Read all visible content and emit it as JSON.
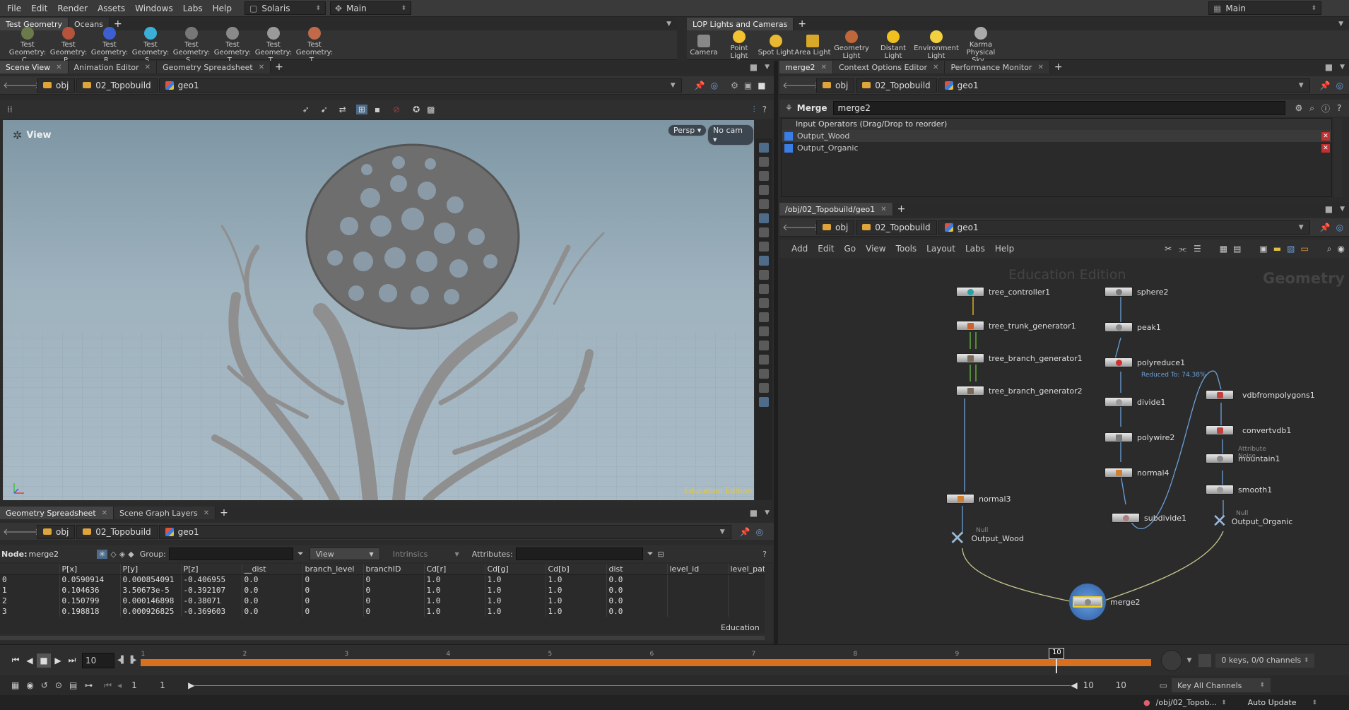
{
  "menubar": {
    "items": [
      "File",
      "Edit",
      "Render",
      "Assets",
      "Windows",
      "Labs",
      "Help"
    ],
    "desktop": "Solaris",
    "context": "Main",
    "right_desktop": "Main"
  },
  "shelf_left": {
    "tabs": [
      "Test Geometry",
      "Oceans"
    ],
    "items": [
      "Test Geometry: C...",
      "Test Geometry: P...",
      "Test Geometry: R...",
      "Test Geometry: S...",
      "Test Geometry: S...",
      "Test Geometry: T...",
      "Test Geometry: T...",
      "Test Geometry: T..."
    ]
  },
  "shelf_right": {
    "tabs": [
      "LOP Lights and Cameras"
    ],
    "items": [
      "Camera",
      "Point Light",
      "Spot Light",
      "Area Light",
      "Geometry Light",
      "Distant Light",
      "Environment Light",
      "Karma Physical Sky..."
    ]
  },
  "left_top_tabs": [
    "Scene View",
    "Animation Editor",
    "Geometry Spreadsheet"
  ],
  "path": {
    "obj": "obj",
    "net": "02_Topobuild",
    "geo": "geo1"
  },
  "viewport": {
    "label": "View",
    "persp": "Persp",
    "cam": "No cam",
    "watermark": "Education Edition"
  },
  "right_top_tabs": [
    "merge2",
    "Context Options Editor",
    "Performance Monitor"
  ],
  "parm": {
    "type": "Merge",
    "name": "merge2",
    "list_header": "Input Operators (Drag/Drop to reorder)",
    "inputs": [
      "Output_Wood",
      "Output_Organic"
    ]
  },
  "network": {
    "tab": "/obj/02_Topobuild/geo1",
    "menu": [
      "Add",
      "Edit",
      "Go",
      "View",
      "Tools",
      "Layout",
      "Labs",
      "Help"
    ],
    "watermark": "Education Edition",
    "context_label": "Geometry",
    "nodes": {
      "n1": "tree_controller1",
      "n2": "tree_trunk_generator1",
      "n3": "tree_branch_generator1",
      "n4": "tree_branch_generator2",
      "n5": "normal3",
      "n6": "Output_Wood",
      "n6sub": "Null",
      "n7": "sphere2",
      "n8": "peak1",
      "n9": "polyreduce1",
      "n9note": "Reduced To: 74.38%",
      "n10": "divide1",
      "n11": "polywire2",
      "n12": "normal4",
      "n13": "subdivide1",
      "n14": "vdbfrompolygons1",
      "n15": "convertvdb1",
      "n16": "mountain1",
      "n16sub": "Attribute Noise",
      "n17": "smooth1",
      "n18": "Output_Organic",
      "n18sub": "Null",
      "n19": "merge2"
    }
  },
  "spreadsheet": {
    "tabs": [
      "Geometry Spreadsheet",
      "Scene Graph Layers"
    ],
    "node_label": "Node:",
    "node": "merge2",
    "group_label": "Group:",
    "view": "View",
    "intrinsics": "Intrinsics",
    "attributes_label": "Attributes:",
    "columns": [
      "",
      "P[x]",
      "P[y]",
      "P[z]",
      "__dist",
      "branch_level",
      "branchID",
      "Cd[r]",
      "Cd[g]",
      "Cd[b]",
      "dist",
      "level_id",
      "level_path"
    ],
    "rows": [
      [
        "0",
        "0.0590914",
        "0.000854091",
        "-0.406955",
        "0.0",
        "0",
        "0",
        "1.0",
        "1.0",
        "1.0",
        "0.0",
        "",
        ""
      ],
      [
        "1",
        "0.104636",
        "3.50673e-5",
        "-0.392107",
        "0.0",
        "0",
        "0",
        "1.0",
        "1.0",
        "1.0",
        "0.0",
        "",
        ""
      ],
      [
        "2",
        "0.150799",
        "0.000146898",
        "-0.38071",
        "0.0",
        "0",
        "0",
        "1.0",
        "1.0",
        "1.0",
        "0.0",
        "",
        ""
      ],
      [
        "3",
        "0.198818",
        "0.000926825",
        "-0.369603",
        "0.0",
        "0",
        "0",
        "1.0",
        "1.0",
        "1.0",
        "0.0",
        "",
        ""
      ]
    ],
    "watermark": "Education"
  },
  "timeline": {
    "frame": "10",
    "ticks": [
      "1",
      "2",
      "3",
      "4",
      "5",
      "6",
      "7",
      "8",
      "9",
      "10"
    ],
    "start": "1",
    "start2": "1",
    "end": "10",
    "end2": "10",
    "keys": "0 keys, 0/0 channels",
    "key_mode": "Key All Channels"
  },
  "status": {
    "path": "/obj/02_Topob...",
    "update": "Auto Update"
  }
}
